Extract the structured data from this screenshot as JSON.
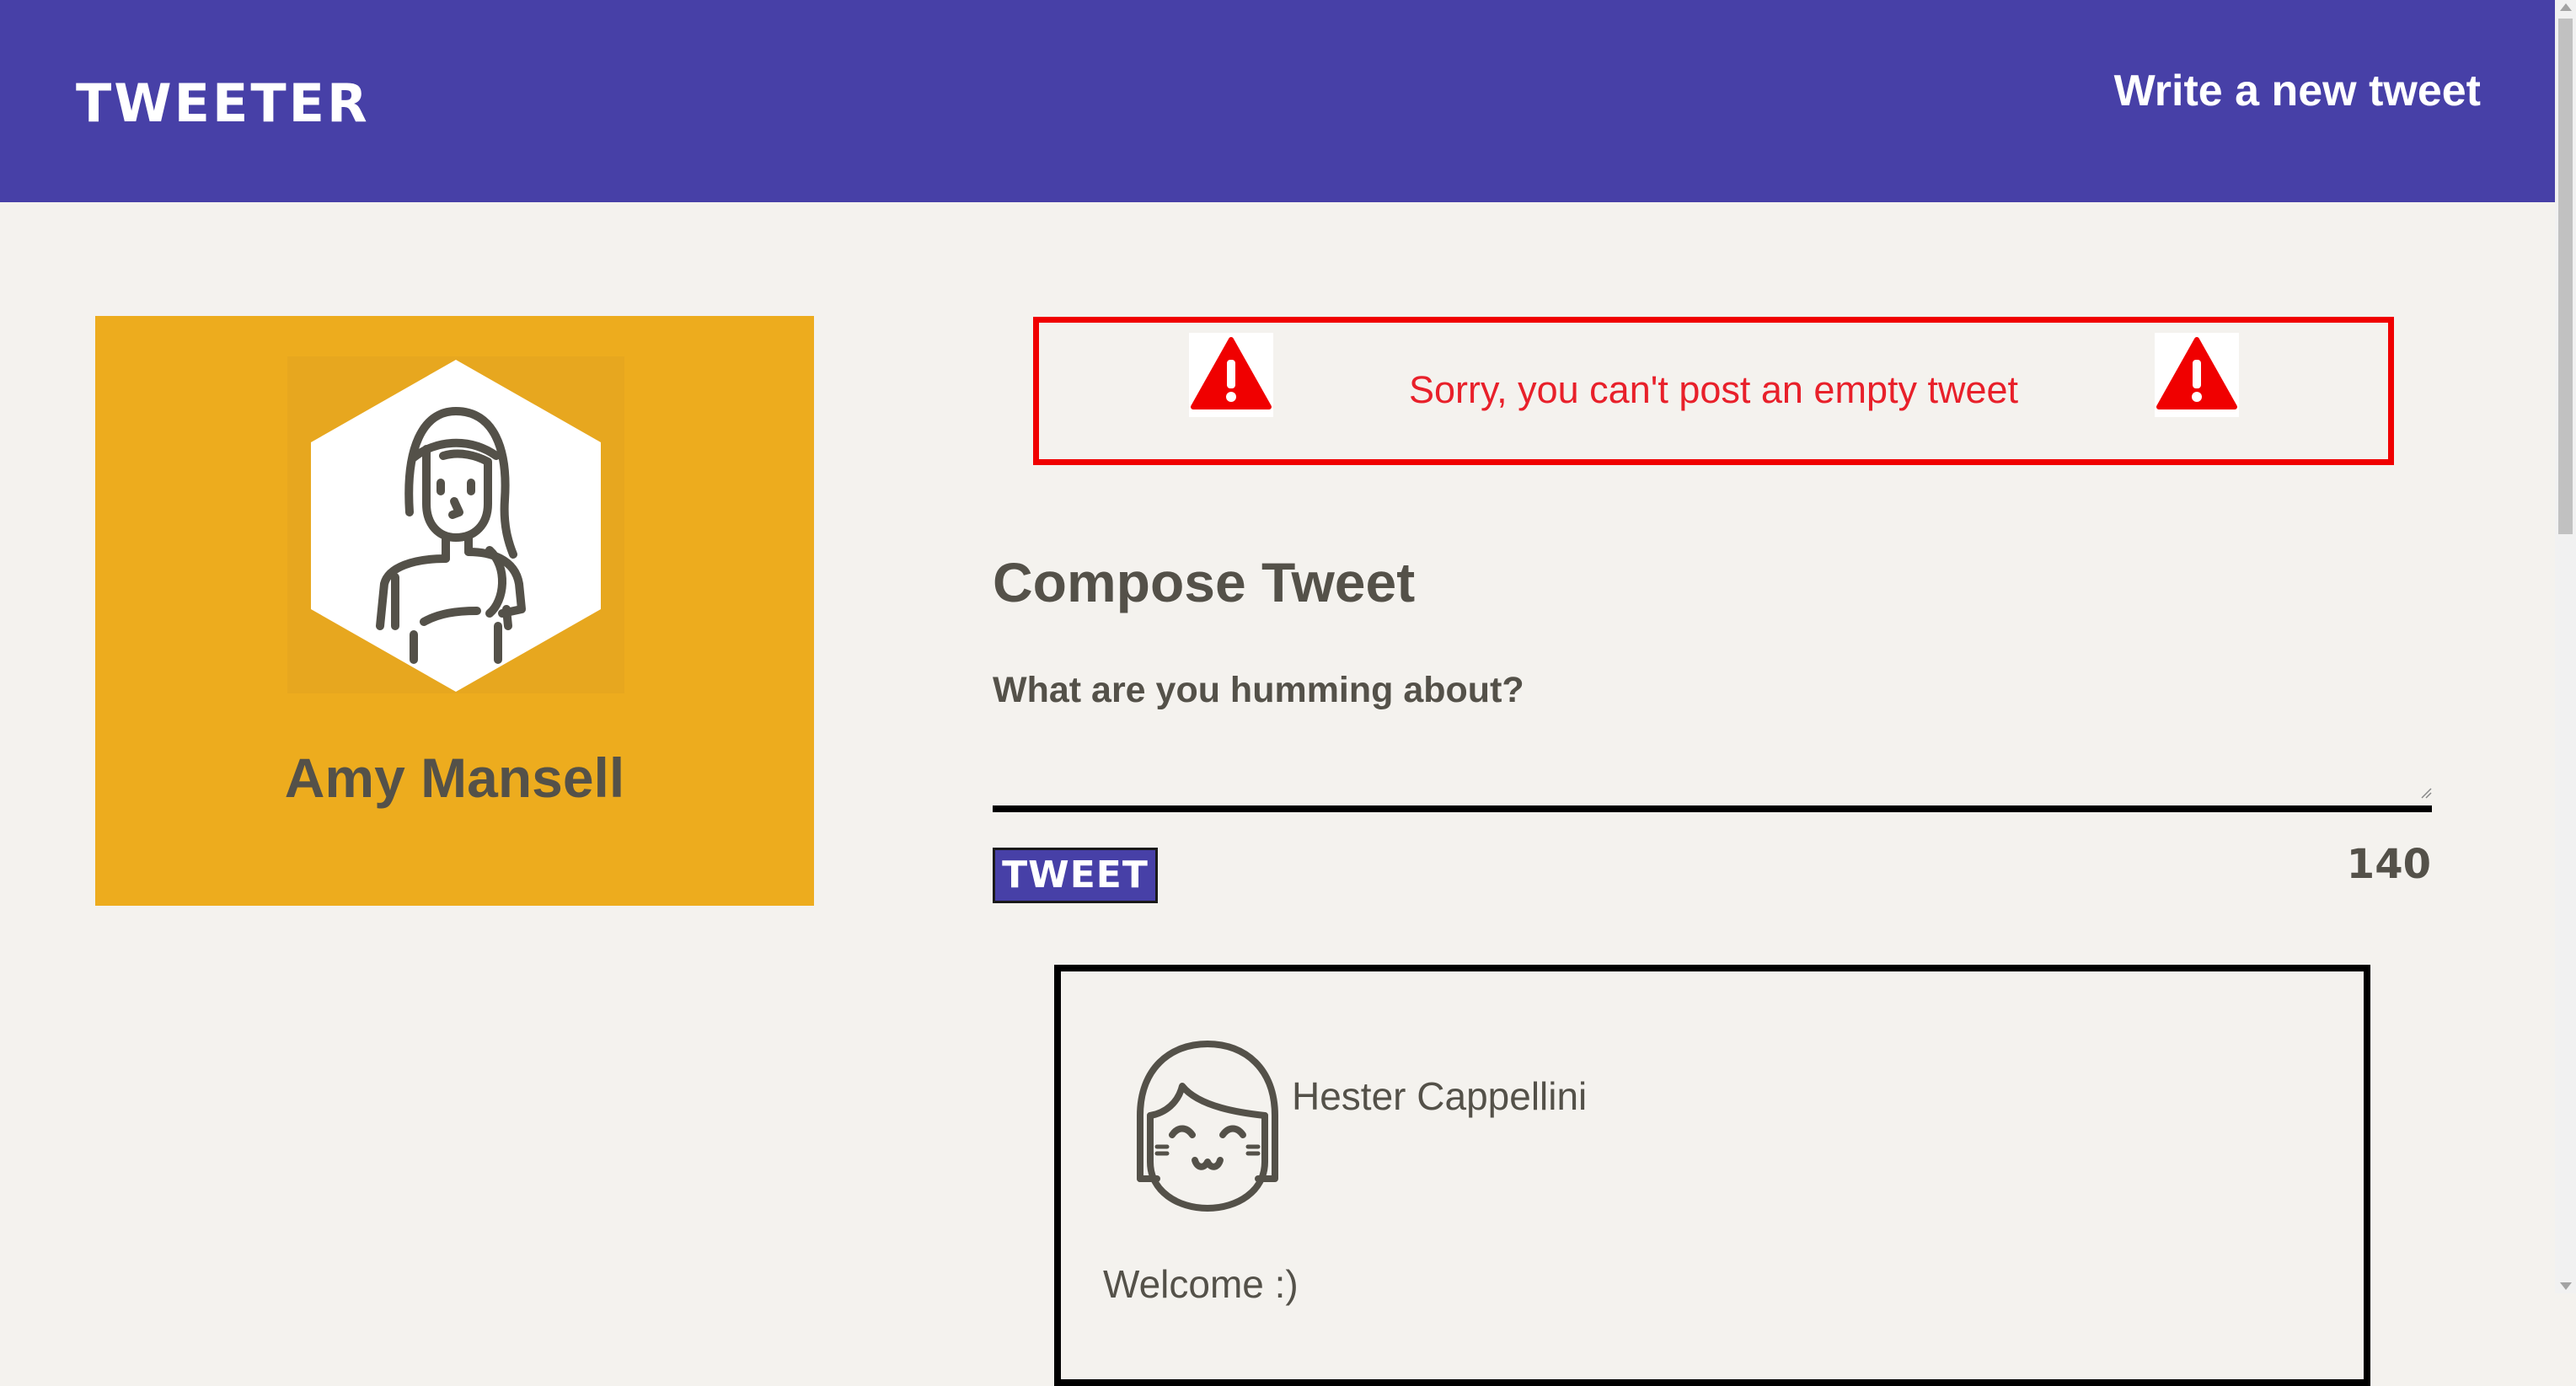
{
  "nav": {
    "brand": "TWEETER",
    "write_link": "Write a new tweet"
  },
  "profile": {
    "name": "Amy Mansell",
    "avatar_icon": "woman-avatar-icon",
    "card_color": "#edac1e"
  },
  "error": {
    "message": "Sorry, you can't post an empty tweet",
    "icon": "warning-icon",
    "color": "#f00000"
  },
  "compose": {
    "title": "Compose Tweet",
    "label": "What are you humming about?",
    "input_value": "",
    "button_label": "TWEET",
    "counter": "140"
  },
  "tweets": [
    {
      "author": "Hester Cappellini",
      "avatar_icon": "girl-avatar-icon",
      "text": "Welcome :)"
    }
  ],
  "colors": {
    "brand": "#4740a7",
    "background": "#f4f2ee",
    "text": "#545149"
  }
}
